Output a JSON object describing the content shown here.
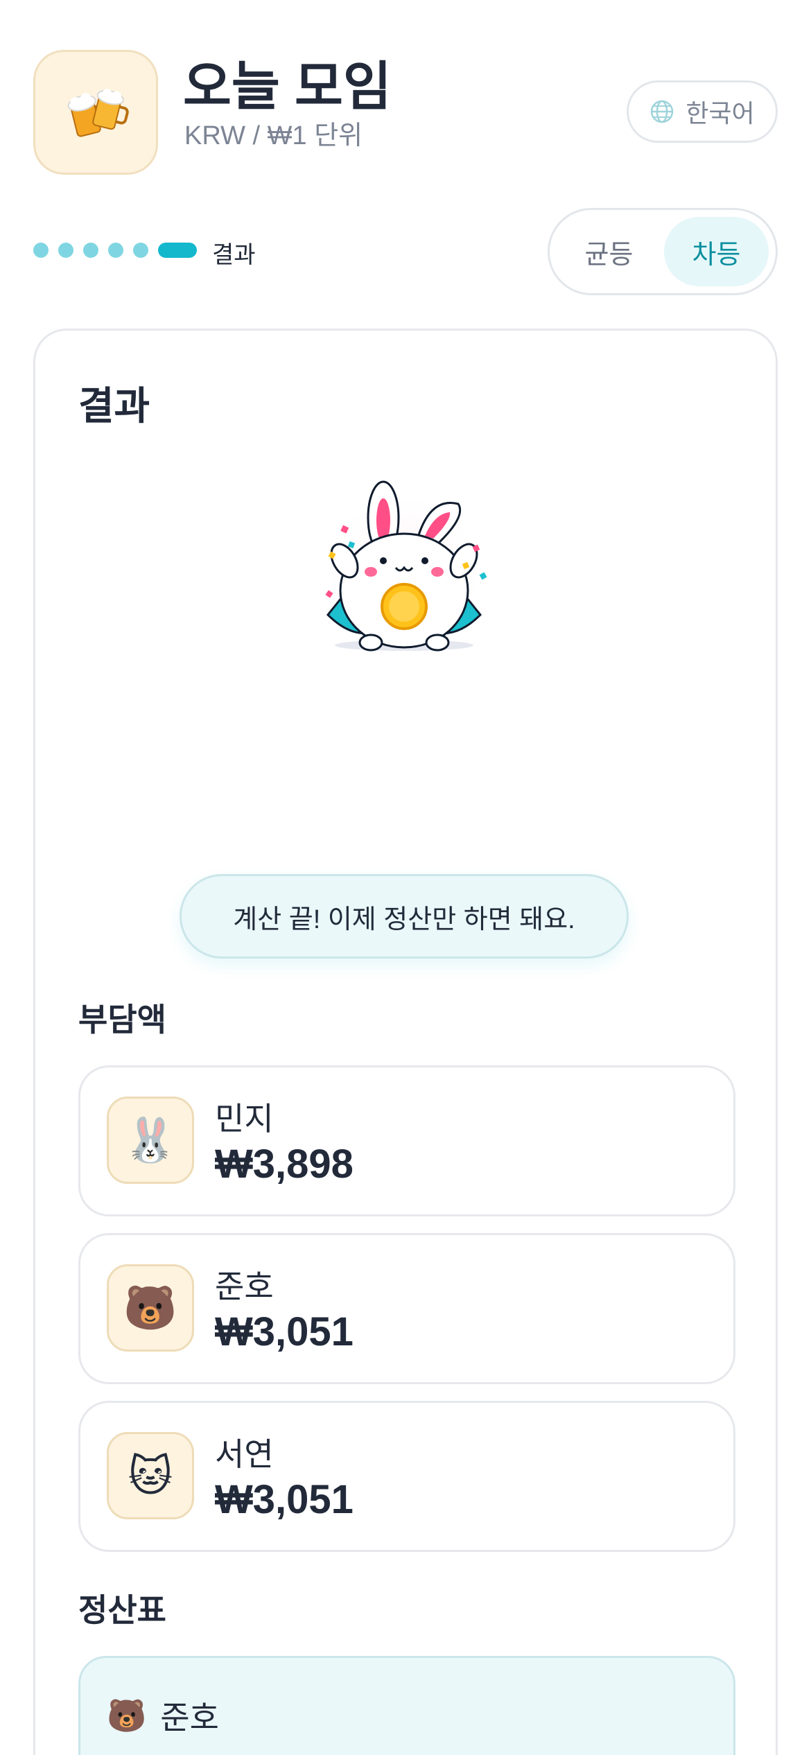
{
  "header": {
    "app_icon": "beer-mugs-icon",
    "title": "오늘 모임",
    "subtitle": "KRW / ₩1 단위",
    "language_label": "한국어",
    "language_icon": "globe-icon"
  },
  "steps": {
    "total": 6,
    "current": 6,
    "current_label": "결과"
  },
  "split_mode": {
    "options": [
      "균등",
      "차등"
    ],
    "selected": "차등"
  },
  "result": {
    "title": "결과",
    "mascot": "bunny-with-coin-illustration",
    "message": "계산 끝! 이제 정산만 하면 돼요."
  },
  "shares": {
    "title": "부담액",
    "items": [
      {
        "avatar": "🐰",
        "name": "민지",
        "amount": "₩3,898"
      },
      {
        "avatar": "🐻",
        "name": "준호",
        "amount": "₩3,051"
      },
      {
        "avatar": "🐱",
        "name": "서연",
        "amount": "₩3,051"
      }
    ]
  },
  "settlement": {
    "title": "정산표",
    "items": [
      {
        "avatar": "🐻",
        "name": "준호"
      }
    ]
  },
  "colors": {
    "accent": "#13b8cc",
    "accent_soft": "#eaf8fa",
    "avatar_bg": "#fdf3df",
    "text": "#222a3a"
  }
}
